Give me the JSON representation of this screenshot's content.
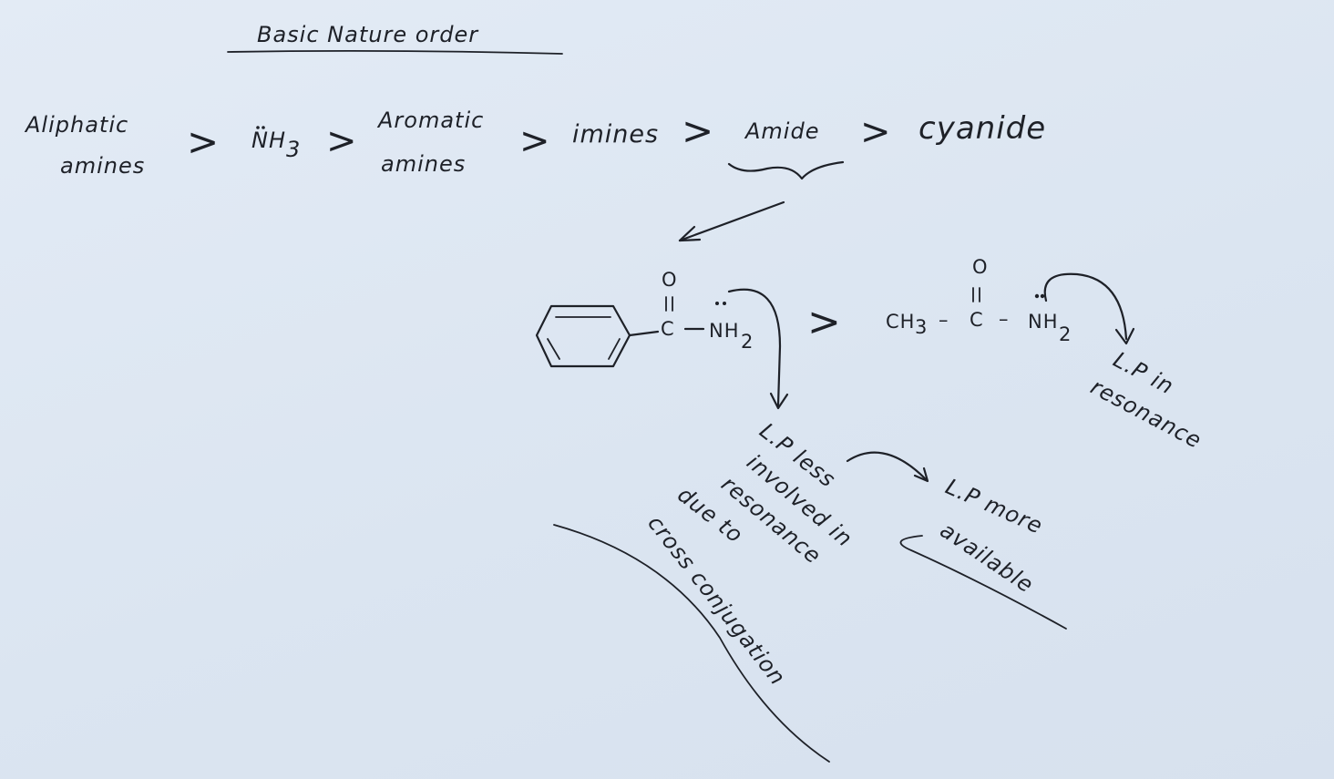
{
  "title": "Basic Nature order",
  "order": {
    "item1_line1": "Aliphatic",
    "item1_line2": "amines",
    "item2": "NH",
    "item2_sub": "3",
    "item3_line1": "Aromatic",
    "item3_line2": "amines",
    "item4": "imines",
    "item5": "Amide",
    "item6": "cyanide",
    "separator": ">"
  },
  "comparison": {
    "left_carbonyl_o": "O",
    "left_carbon": "C",
    "left_nh": "NH",
    "left_sub": "2",
    "operator": ">",
    "right_ch": "CH",
    "right_ch_sub": "3",
    "right_dash1": "–",
    "right_carbonyl_o": "O",
    "right_carbon": "C",
    "right_dash2": "–",
    "right_nh": "NH",
    "right_nh_sub": "2"
  },
  "notes": {
    "lp_less_1": "L.P less",
    "lp_less_2": "involved in",
    "lp_less_3": "resonance",
    "lp_less_4": "due to",
    "lp_less_5": "cross conjugation",
    "lp_more_1": "L.P more",
    "lp_more_2": "available",
    "lp_res_1": "L.P in",
    "lp_res_2": "resonance"
  }
}
